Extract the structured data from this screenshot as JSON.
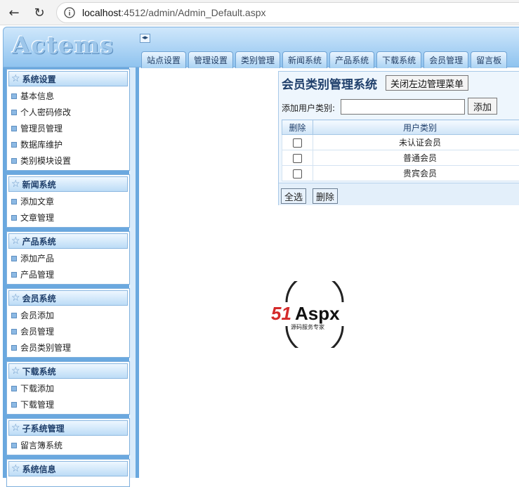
{
  "browser": {
    "url_host": "localhost",
    "url_rest": ":4512/admin/Admin_Default.aspx"
  },
  "header": {
    "logo_text": "Actems",
    "toggle_symbol": "◂▸",
    "tabs": [
      "站点设置",
      "管理设置",
      "类别管理",
      "新闻系统",
      "产品系统",
      "下载系统",
      "会员管理",
      "留言板"
    ]
  },
  "sidebar": {
    "groups": [
      {
        "title": "系统设置",
        "items": [
          "基本信息",
          "个人密码修改",
          "管理员管理",
          "数据库维护",
          "类别模块设置"
        ]
      },
      {
        "title": "新闻系统",
        "items": [
          "添加文章",
          "文章管理"
        ]
      },
      {
        "title": "产品系统",
        "items": [
          "添加产品",
          "产品管理"
        ]
      },
      {
        "title": "会员系统",
        "items": [
          "会员添加",
          "会员管理",
          "会员类别管理"
        ]
      },
      {
        "title": "下载系统",
        "items": [
          "下载添加",
          "下载管理"
        ]
      },
      {
        "title": "子系统管理",
        "items": [
          "留言簿系统"
        ]
      },
      {
        "title": "系统信息",
        "items": []
      }
    ]
  },
  "main": {
    "title": "会员类别管理系统",
    "close_menu_button": "关闭左边管理菜单",
    "add_label": "添加用户类别:",
    "add_input_value": "",
    "add_button": "添加",
    "table": {
      "columns": [
        "删除",
        "用户类别"
      ],
      "rows": [
        "未认证会员",
        "普通会员",
        "贵宾会员"
      ]
    },
    "select_all_button": "全选",
    "delete_button": "删除"
  },
  "watermark": {
    "brand_51": "51",
    "brand_aspx": "Aspx",
    "tagline": "源码服务专家"
  }
}
